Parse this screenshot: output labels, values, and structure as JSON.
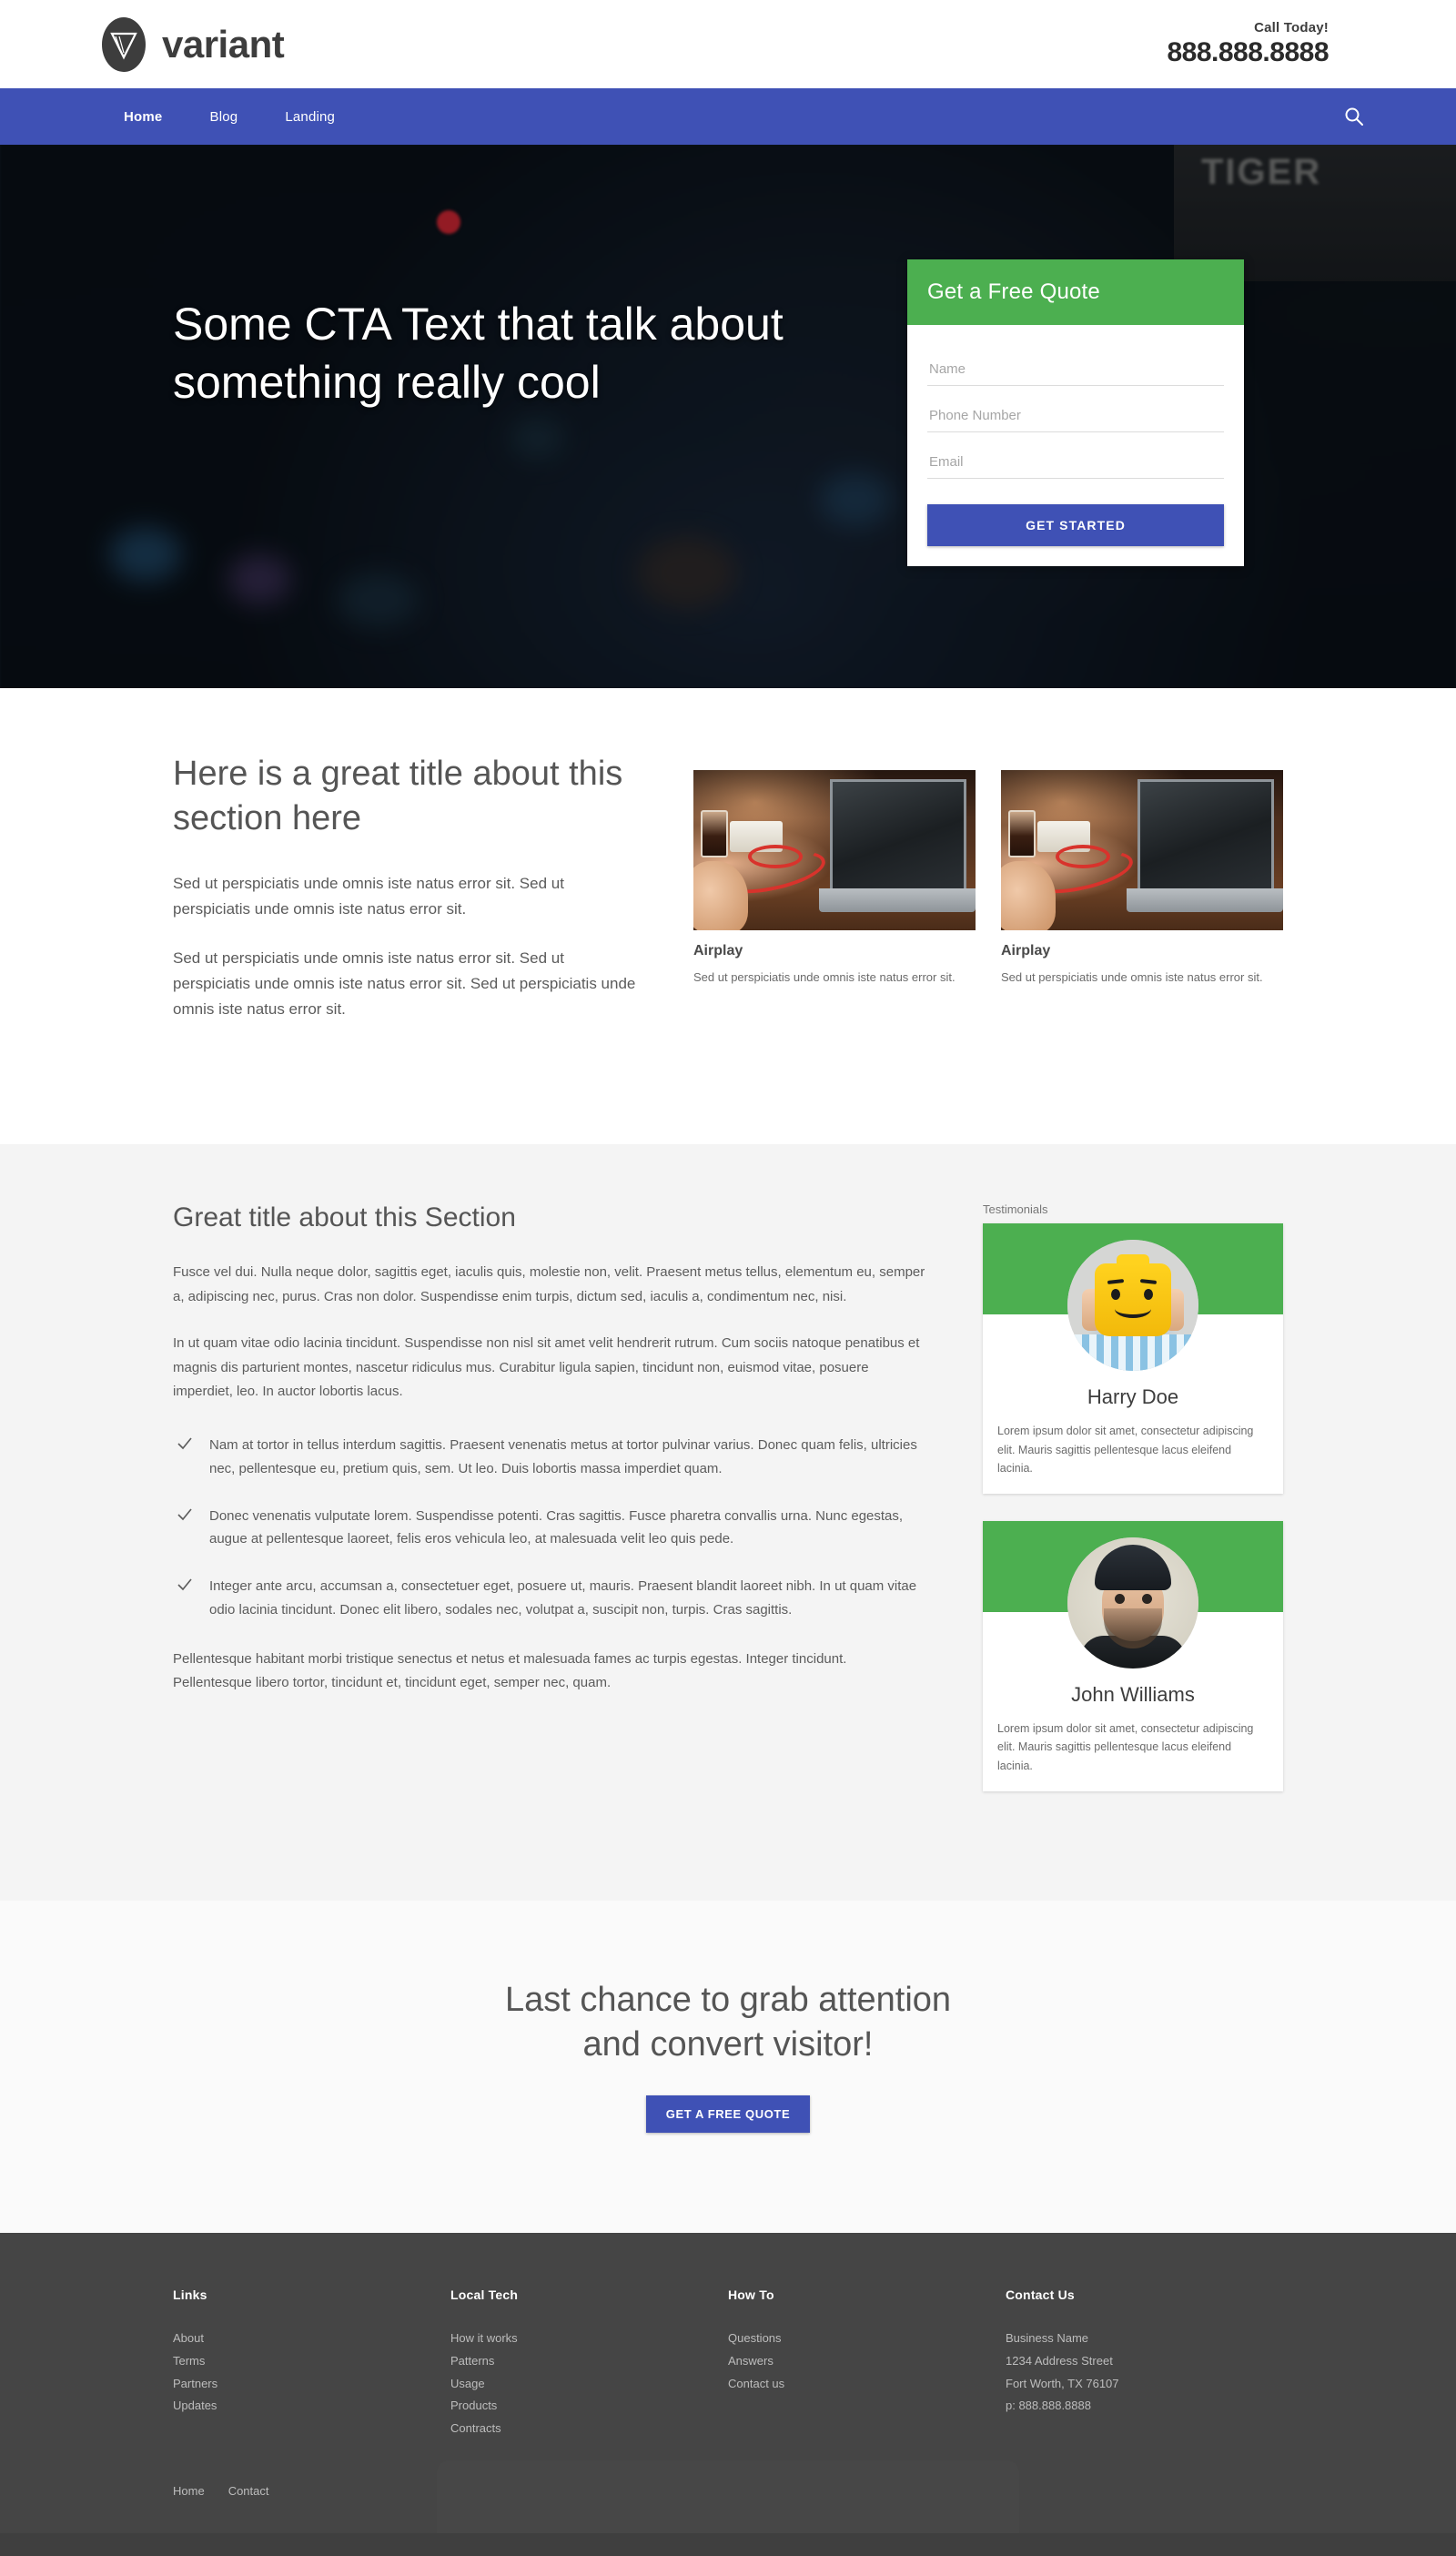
{
  "header": {
    "brand_name": "variant",
    "brand_icon": "triangle-logo-icon",
    "call_label": "Call Today!",
    "phone": "888.888.8888"
  },
  "nav": {
    "items": [
      {
        "label": "Home",
        "active": true
      },
      {
        "label": "Blog",
        "active": false
      },
      {
        "label": "Landing",
        "active": false
      }
    ],
    "search_icon": "search-icon",
    "background_color": "#3f51b5"
  },
  "hero": {
    "title": "Some CTA Text that talk about something really cool",
    "quote_form": {
      "heading": "Get a Free Quote",
      "header_color": "#4caf50",
      "fields": [
        {
          "name": "name",
          "placeholder": "Name",
          "value": ""
        },
        {
          "name": "phone",
          "placeholder": "Phone Number",
          "value": ""
        },
        {
          "name": "email",
          "placeholder": "Email",
          "value": ""
        }
      ],
      "submit_label": "GET STARTED",
      "submit_color": "#3f51b5"
    }
  },
  "features": {
    "title": "Here is a great title about this section here",
    "paragraphs": [
      "Sed ut perspiciatis unde omnis iste natus error sit. Sed ut perspiciatis unde omnis iste natus error sit.",
      "Sed ut perspiciatis unde omnis iste natus error sit. Sed ut perspiciatis unde omnis iste natus error sit. Sed ut perspiciatis unde omnis iste natus error sit."
    ],
    "cards": [
      {
        "title": "Airplay",
        "text": "Sed ut perspiciatis unde omnis iste natus error sit."
      },
      {
        "title": "Airplay",
        "text": "Sed ut perspiciatis unde omnis iste natus error sit."
      }
    ]
  },
  "content": {
    "title": "Great title about this Section",
    "paragraphs": [
      "Fusce vel dui. Nulla neque dolor, sagittis eget, iaculis quis, molestie non, velit. Praesent metus tellus, elementum eu, semper a, adipiscing nec, purus. Cras non dolor. Suspendisse enim turpis, dictum sed, iaculis a, condimentum nec, nisi.",
      "In ut quam vitae odio lacinia tincidunt. Suspendisse non nisl sit amet velit hendrerit rutrum. Cum sociis natoque penatibus et magnis dis parturient montes, nascetur ridiculus mus. Curabitur ligula sapien, tincidunt non, euismod vitae, posuere imperdiet, leo. In auctor lobortis lacus."
    ],
    "check_icon": "check-icon",
    "checklist": [
      "Nam at tortor in tellus interdum sagittis. Praesent venenatis metus at tortor pulvinar varius. Donec quam felis, ultricies nec, pellentesque eu, pretium quis, sem. Ut leo. Duis lobortis massa imperdiet quam.",
      "Donec venenatis vulputate lorem. Suspendisse potenti. Cras sagittis. Fusce pharetra convallis urna. Nunc egestas, augue at pellentesque laoreet, felis eros vehicula leo, at malesuada velit leo quis pede.",
      "Integer ante arcu, accumsan a, consectetuer eget, posuere ut, mauris. Praesent blandit laoreet nibh. In ut quam vitae odio lacinia tincidunt. Donec elit libero, sodales nec, volutpat a, suscipit non, turpis. Cras sagittis."
    ],
    "closing_paragraph": "Pellentesque habitant morbi tristique senectus et netus et malesuada fames ac turpis egestas. Integer tincidunt. Pellentesque libero tortor, tincidunt et, tincidunt eget, semper nec, quam."
  },
  "testimonials": {
    "label": "Testimonials",
    "banner_color": "#4caf50",
    "items": [
      {
        "name": "Harry Doe",
        "avatar": "lego-head-avatar",
        "text": "Lorem ipsum dolor sit amet, consectetur adipiscing elit. Mauris sagittis pellentesque lacus eleifend lacinia."
      },
      {
        "name": "John Williams",
        "avatar": "bearded-man-avatar",
        "text": "Lorem ipsum dolor sit amet, consectetur adipiscing elit. Mauris sagittis pellentesque lacus eleifend lacinia."
      }
    ]
  },
  "cta": {
    "line1": "Last chance to grab attention",
    "line2": "and convert visitor!",
    "button_label": "GET A FREE QUOTE",
    "button_color": "#3f51b5"
  },
  "footer": {
    "background_color": "#454545",
    "columns": [
      {
        "heading": "Links",
        "links": [
          "About",
          "Terms",
          "Partners",
          "Updates"
        ]
      },
      {
        "heading": "Local Tech",
        "links": [
          "How it works",
          "Patterns",
          "Usage",
          "Products",
          "Contracts"
        ]
      },
      {
        "heading": "How To",
        "links": [
          "Questions",
          "Answers",
          "Contact us"
        ]
      },
      {
        "heading": "Contact Us",
        "links": [
          "Business Name",
          "1234 Address Street",
          "Fort Worth, TX 76107",
          "p: 888.888.8888"
        ]
      }
    ],
    "bottom_links": [
      "Home",
      "Contact"
    ]
  }
}
